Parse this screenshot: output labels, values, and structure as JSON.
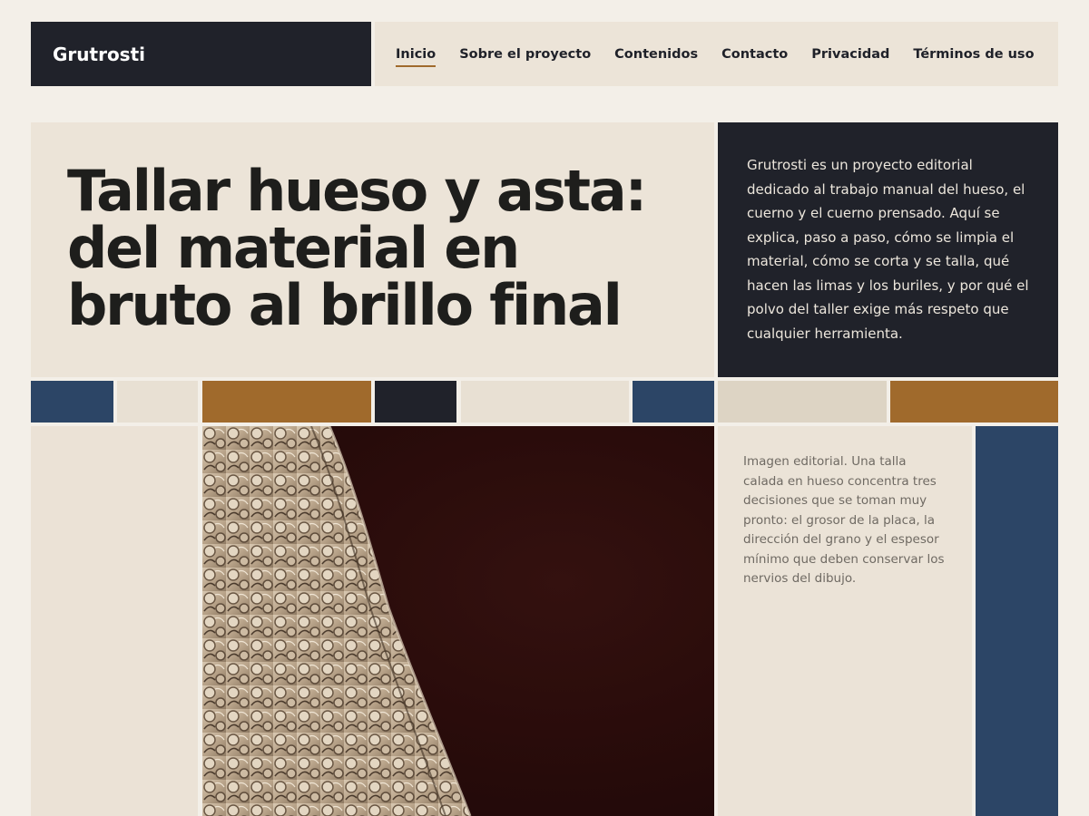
{
  "header": {
    "brand": "Grutrosti",
    "nav": [
      {
        "label": "Inicio",
        "active": true
      },
      {
        "label": "Sobre el proyecto"
      },
      {
        "label": "Contenidos"
      },
      {
        "label": "Contacto"
      },
      {
        "label": "Privacidad"
      },
      {
        "label": "Términos de uso"
      }
    ]
  },
  "hero": {
    "title": "Tallar hueso y asta: del material en bruto al brillo final"
  },
  "intro": {
    "text": "Grutrosti es un proyecto editorial dedicado al trabajo manual del hueso, el cuerno y el cuerno prensado. Aquí se explica, paso a paso, cómo se limpia el material, cómo se corta y se talla, qué hacen las limas y los buriles, y por qué el polvo del taller exige más respeto que cualquier herramienta."
  },
  "caption": {
    "text": "Imagen editorial. Una talla calada en hueso concentra tres decisiones que se toman muy pronto: el grosor de la placa, la dirección del grano y el espesor mínimo que deben conservar los nervios del dibujo."
  },
  "palette": {
    "navy": "#2c4566",
    "sand": "#e8e0d3",
    "ochre": "#a06a2c",
    "ink": "#20222a",
    "stone": "#ddd4c4"
  }
}
